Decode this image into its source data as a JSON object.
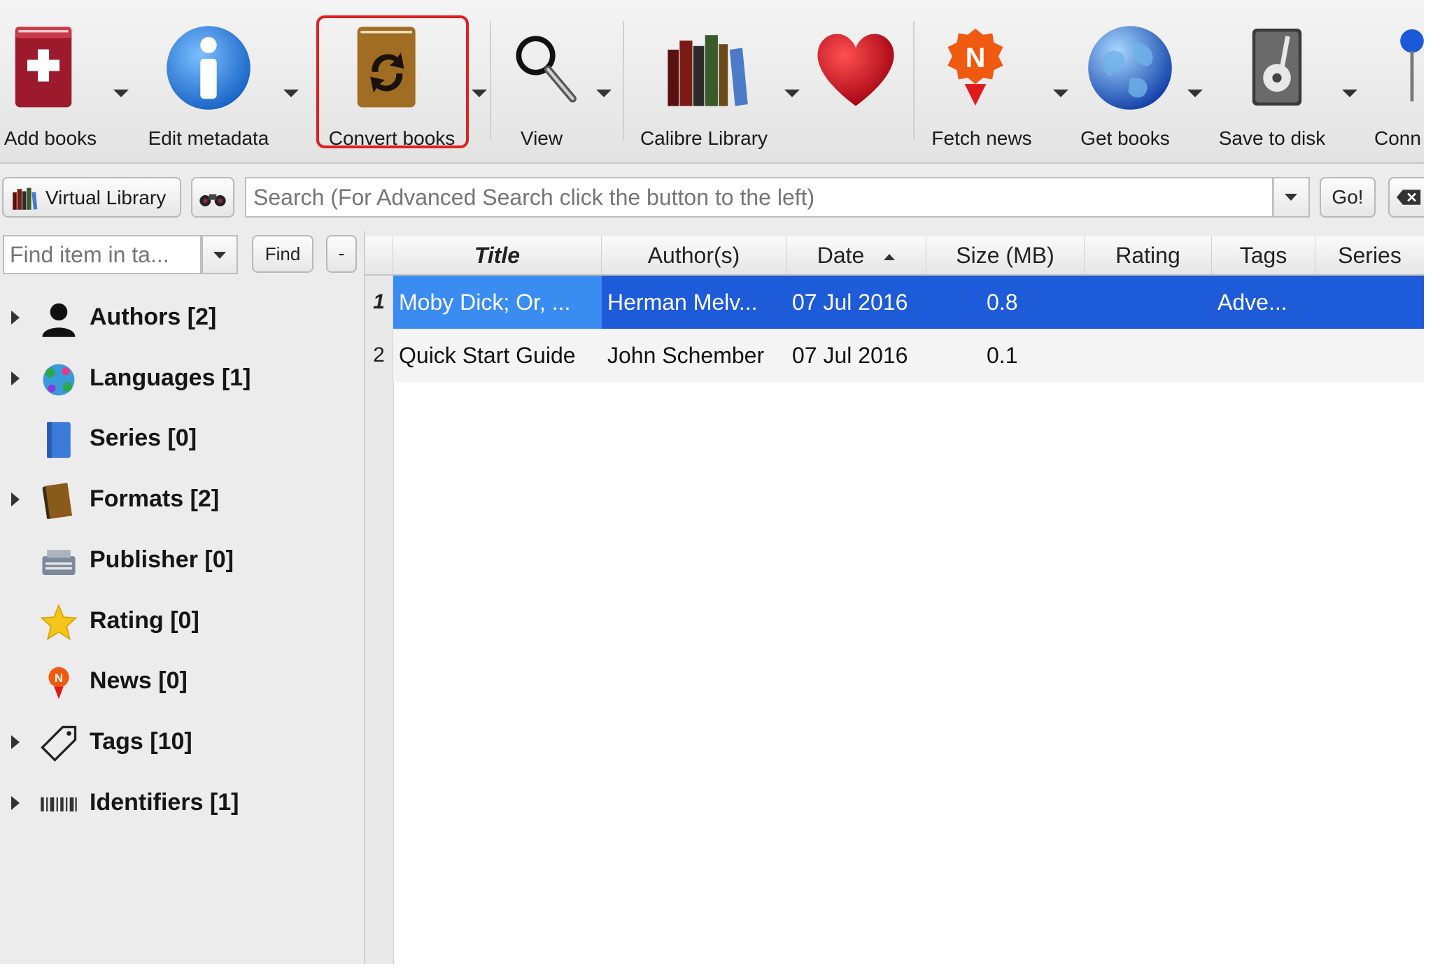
{
  "toolbar": {
    "buttons": [
      {
        "label": "Add books",
        "icon": "add-books-icon"
      },
      {
        "label": "Edit metadata",
        "icon": "info-icon"
      },
      {
        "label": "Convert books",
        "icon": "convert-books-icon"
      },
      {
        "label": "View",
        "icon": "magnifier-icon"
      },
      {
        "label": "Calibre Library",
        "icon": "library-books-icon"
      },
      {
        "label": "",
        "icon": "heart-icon"
      },
      {
        "label": "Fetch news",
        "icon": "news-icon"
      },
      {
        "label": "Get books",
        "icon": "globe-icon"
      },
      {
        "label": "Save to disk",
        "icon": "disk-icon"
      },
      {
        "label": "Conn",
        "icon": "connect-icon"
      }
    ]
  },
  "search": {
    "virtual_library_label": "Virtual Library",
    "placeholder": "Search (For Advanced Search click the button to the left)",
    "go_label": "Go!"
  },
  "tag_browser": {
    "find_placeholder": "Find item in ta...",
    "find_label": "Find",
    "collapse_label": "-",
    "items": [
      {
        "label": "Authors [2]",
        "icon": "person-icon",
        "expandable": true
      },
      {
        "label": "Languages [1]",
        "icon": "languages-icon",
        "expandable": true
      },
      {
        "label": "Series [0]",
        "icon": "series-book-icon",
        "expandable": false
      },
      {
        "label": "Formats [2]",
        "icon": "formats-book-icon",
        "expandable": true
      },
      {
        "label": "Publisher [0]",
        "icon": "publisher-icon",
        "expandable": false
      },
      {
        "label": "Rating [0]",
        "icon": "star-icon",
        "expandable": false
      },
      {
        "label": "News [0]",
        "icon": "news-pin-icon",
        "expandable": false
      },
      {
        "label": "Tags [10]",
        "icon": "tag-icon",
        "expandable": true
      },
      {
        "label": "Identifiers [1]",
        "icon": "barcode-icon",
        "expandable": true
      }
    ]
  },
  "book_list": {
    "columns": [
      "Title",
      "Author(s)",
      "Date",
      "Size (MB)",
      "Rating",
      "Tags",
      "Series"
    ],
    "rows": [
      {
        "num": "1",
        "title": "Moby Dick; Or, ...",
        "authors": "Herman Melv...",
        "date": "07 Jul 2016",
        "size": "0.8",
        "rating": "",
        "tags": "Adve...",
        "series": "",
        "selected": true
      },
      {
        "num": "2",
        "title": "Quick Start Guide",
        "authors": "John Schember",
        "date": "07 Jul 2016",
        "size": "0.1",
        "rating": "",
        "tags": "",
        "series": "",
        "selected": false
      }
    ]
  },
  "colors": {
    "selection": "#1e5bd8",
    "selection_current_cell": "#3b8cf0",
    "highlight_border": "#e02020"
  }
}
